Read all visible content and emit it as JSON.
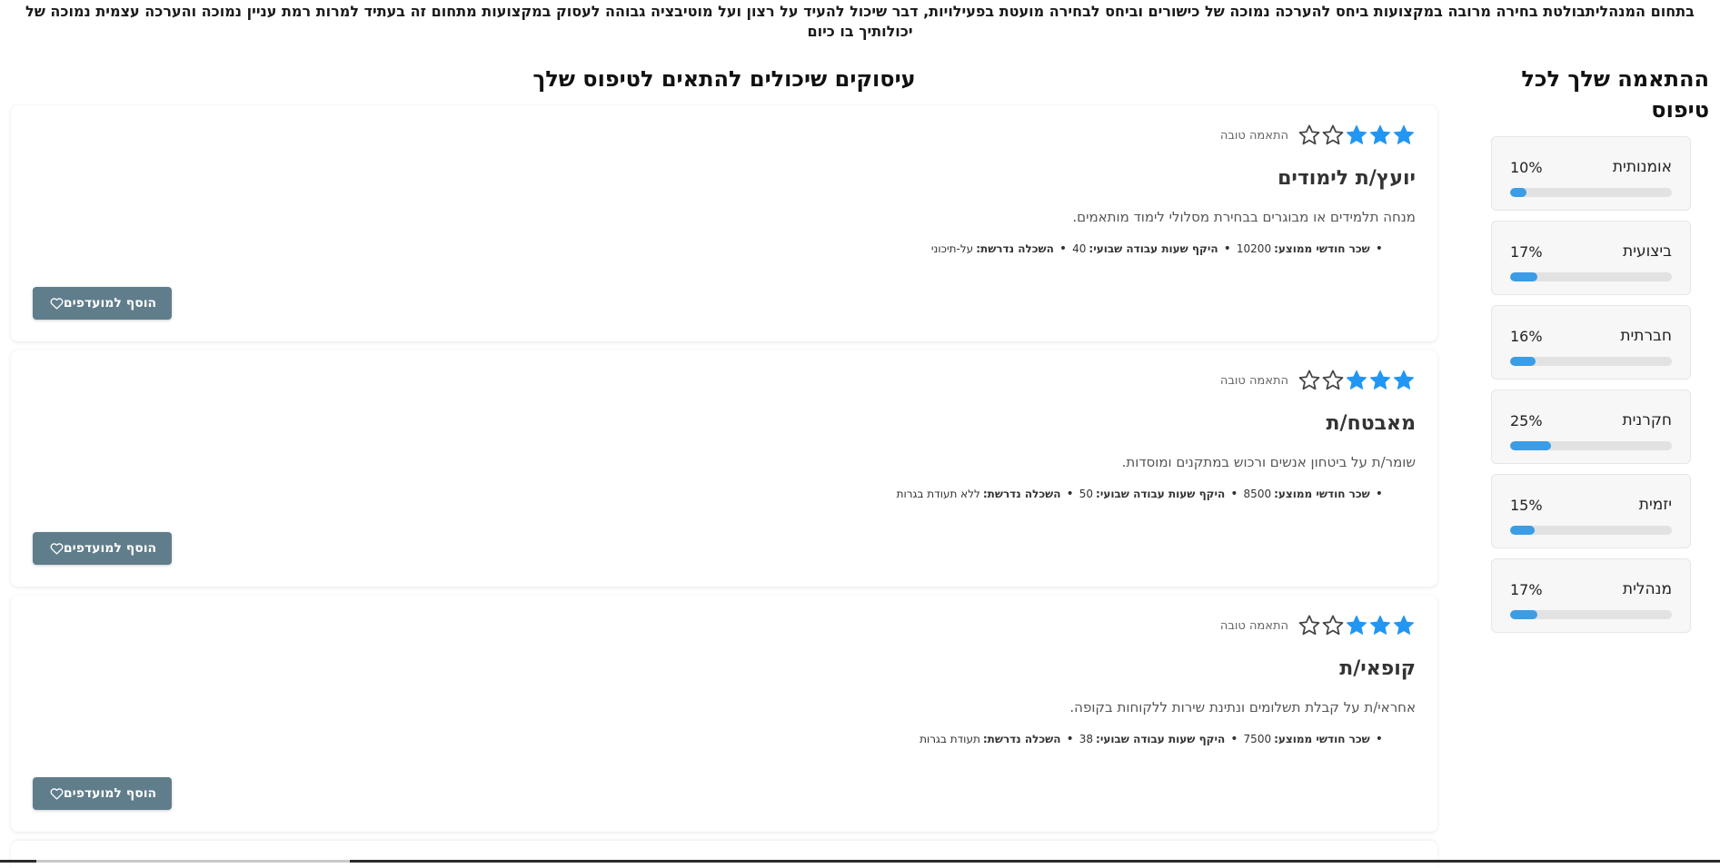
{
  "intro_text": "בתחום המנהליתבולטת בחירה מרובה במקצועות ביחס להערכה נמוכה של כישורים וביחס לבחירה מועטת בפעילויות, דבר שיכול להעיד על רצון ועל מוטיבציה גבוהה לעסוק במקצועות מתחום זה בעתיד למרות רמת עניין נמוכה והערכה עצמית נמוכה של יכולותיך בו כיום",
  "sidebar": {
    "title": "ההתאמה שלך לכל טיפוס",
    "types": [
      {
        "name": "אומנותית",
        "percent_text": "10%",
        "percent": 10
      },
      {
        "name": "ביצועית",
        "percent_text": "17%",
        "percent": 17
      },
      {
        "name": "חברתית",
        "percent_text": "16%",
        "percent": 16
      },
      {
        "name": "חקרנית",
        "percent_text": "25%",
        "percent": 25
      },
      {
        "name": "יזמית",
        "percent_text": "15%",
        "percent": 15
      },
      {
        "name": "מנהלית",
        "percent_text": "17%",
        "percent": 17
      }
    ],
    "bar_color": "#3a9de6"
  },
  "main": {
    "title": "עיסוקים שיכולים להתאים לטיפוס שלך",
    "jobs": [
      {
        "stars_filled": 3,
        "stars_total": 5,
        "match_label": "התאמה טובה",
        "title": "יועץ/ת לימודים",
        "description": "מנחה תלמידים או מבוגרים בבחירת מסלולי לימוד מותאמים.",
        "salary_label": "שכר חודשי ממוצע:",
        "salary_value": "10200",
        "hours_label": "היקף שעות עבודה שבועי:",
        "hours_value": "40",
        "education_label": "השכלה נדרשת:",
        "education_value": "על-תיכוני",
        "fav_label": "הוסף למועדפים"
      },
      {
        "stars_filled": 3,
        "stars_total": 5,
        "match_label": "התאמה טובה",
        "title": "מאבטח/ת",
        "description": "שומר/ת על ביטחון אנשים ורכוש במתקנים ומוסדות.",
        "salary_label": "שכר חודשי ממוצע:",
        "salary_value": "8500",
        "hours_label": "היקף שעות עבודה שבועי:",
        "hours_value": "50",
        "education_label": "השכלה נדרשת:",
        "education_value": "ללא תעודת בגרות",
        "fav_label": "הוסף למועדפים"
      },
      {
        "stars_filled": 3,
        "stars_total": 5,
        "match_label": "התאמה טובה",
        "title": "קופאי/ת",
        "description": "אחראי/ת על קבלת תשלומים ונתינת שירות ללקוחות בקופה.",
        "salary_label": "שכר חודשי ממוצע:",
        "salary_value": "7500",
        "hours_label": "היקף שעות עבודה שבועי:",
        "hours_value": "38",
        "education_label": "השכלה נדרשת:",
        "education_value": "תעודת בגרות",
        "fav_label": "הוסף למועדפים"
      }
    ],
    "star_filled_color": "#2196f3",
    "button_color": "#607d8b"
  }
}
